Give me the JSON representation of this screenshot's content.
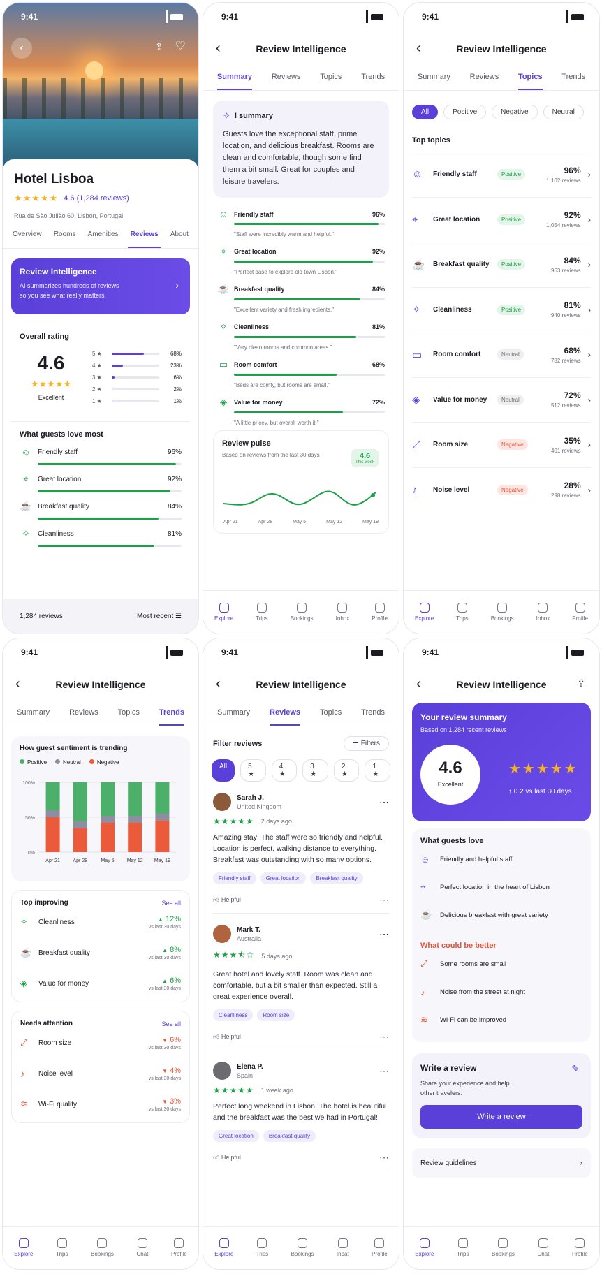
{
  "status_time": "9:41",
  "screen1": {
    "hotel_name": "Hotel Lisboa",
    "rating": "4.6 (1,284 reviews)",
    "address": "Rua de São Julião 60, Lisbon, Portugal",
    "tabs": [
      "Overview",
      "Rooms",
      "Amenities",
      "Reviews",
      "About"
    ],
    "ri_title": "Review Intelligence",
    "ri_desc_1": "AI summarizes hundreds of reviews",
    "ri_desc_2": "so you see what really matters.",
    "overall_title": "Overall rating",
    "overall_score": "4.6",
    "overall_label": "Excellent",
    "dist": [
      {
        "s": "5 ★",
        "p": "68%",
        "v": 68
      },
      {
        "s": "4 ★",
        "p": "23%",
        "v": 23
      },
      {
        "s": "3 ★",
        "p": "6%",
        "v": 6
      },
      {
        "s": "2 ★",
        "p": "2%",
        "v": 2
      },
      {
        "s": "1 ★",
        "p": "1%",
        "v": 1
      }
    ],
    "love_title": "What guests love most",
    "love": [
      {
        "n": "Friendly staff",
        "p": "96%",
        "v": 96
      },
      {
        "n": "Great location",
        "p": "92%",
        "v": 92
      },
      {
        "n": "Breakfast quality",
        "p": "84%",
        "v": 84
      },
      {
        "n": "Cleanliness",
        "p": "81%",
        "v": 81
      }
    ],
    "count": "1,284 reviews",
    "sort": "Most recent"
  },
  "app_title": "Review Intelligence",
  "tabs2": [
    "Summary",
    "Reviews",
    "Topics",
    "Trends"
  ],
  "screen2": {
    "ai_title": "I summary",
    "ai_text": "Guests love the exceptional staff, prime location, and delicious breakfast. Rooms are clean and comfortable, though some find them a bit small. Great for couples and leisure travelers.",
    "items": [
      {
        "n": "Friendly staff",
        "p": "96%",
        "v": 96,
        "q": "\"Staff were incredibly warm and helpful.\""
      },
      {
        "n": "Great location",
        "p": "92%",
        "v": 92,
        "q": "\"Perfect base to explore old town Lisbon.\""
      },
      {
        "n": "Breakfast quality",
        "p": "84%",
        "v": 84,
        "q": "\"Excellent variety and fresh ingredients.\""
      },
      {
        "n": "Cleanliness",
        "p": "81%",
        "v": 81,
        "q": "\"Very clean rooms and common areas.\""
      },
      {
        "n": "Room comfort",
        "p": "68%",
        "v": 68,
        "q": "\"Beds are comfy, but rooms are small.\""
      },
      {
        "n": "Value for money",
        "p": "72%",
        "v": 72,
        "q": "\"A little pricey, but overall worth it.\""
      }
    ],
    "pulse_title": "Review pulse",
    "pulse_sub": "Based on reviews from the last 30 days",
    "pulse_val": "4.6",
    "pulse_week": "This week",
    "pulse_dates": [
      "Apr 21",
      "Apr 28",
      "May 5",
      "May 12",
      "May 19"
    ]
  },
  "nav1": [
    "Explore",
    "Trips",
    "Bookings",
    "Inbox",
    "Profile"
  ],
  "nav2": [
    "Explore",
    "Trips",
    "Bookings",
    "Chat",
    "Profile"
  ],
  "nav3": [
    "Explore",
    "Trips",
    "Bookings",
    "Inbat",
    "Profile"
  ],
  "screen3": {
    "filters": [
      "All",
      "Positive",
      "Negative",
      "Neutral"
    ],
    "section": "Top topics",
    "topics": [
      {
        "n": "Friendly staff",
        "b": "Positive",
        "c": "pos",
        "p": "96%",
        "r": "1,102 reviews"
      },
      {
        "n": "Great location",
        "b": "Positive",
        "c": "pos",
        "p": "92%",
        "r": "1,054 reviews"
      },
      {
        "n": "Breakfast quality",
        "b": "Positive",
        "c": "pos",
        "p": "84%",
        "r": "963 reviews"
      },
      {
        "n": "Cleanliness",
        "b": "Positive",
        "c": "pos",
        "p": "81%",
        "r": "940 reviews"
      },
      {
        "n": "Room comfort",
        "b": "Neutral",
        "c": "neu",
        "p": "68%",
        "r": "782 reviews"
      },
      {
        "n": "Value for money",
        "b": "Neutral",
        "c": "neu",
        "p": "72%",
        "r": "512 reviews"
      },
      {
        "n": "Room size",
        "b": "Negative",
        "c": "neg",
        "p": "35%",
        "r": "401 reviews"
      },
      {
        "n": "Noise level",
        "b": "Negative",
        "c": "neg",
        "p": "28%",
        "r": "298 reviews"
      }
    ]
  },
  "screen4": {
    "chart_title": "How guest sentiment is trending",
    "legend": [
      "Positive",
      "Neutral",
      "Negative"
    ],
    "yticks": [
      "100%",
      "50%",
      "0%"
    ],
    "improving_title": "Top improving",
    "see_all": "See all",
    "improving": [
      {
        "n": "Cleanliness",
        "d": "12%"
      },
      {
        "n": "Breakfast quality",
        "d": "8%"
      },
      {
        "n": "Value for money",
        "d": "6%"
      }
    ],
    "attention_title": "Needs attention",
    "attention": [
      {
        "n": "Room size",
        "d": "6%"
      },
      {
        "n": "Noise level",
        "d": "4%"
      },
      {
        "n": "Wi-Fi quality",
        "d": "3%"
      }
    ],
    "vs": "vs last 30 days"
  },
  "chart_data": {
    "type": "bar",
    "title": "How guest sentiment is trending",
    "categories": [
      "Apr 21",
      "Apr 28",
      "May 5",
      "May 12",
      "May 19"
    ],
    "series": [
      {
        "name": "Positive",
        "values": [
          40,
          56,
          48,
          48,
          45
        ]
      },
      {
        "name": "Neutral",
        "values": [
          10,
          10,
          10,
          10,
          10
        ]
      },
      {
        "name": "Negative",
        "values": [
          50,
          34,
          42,
          42,
          45
        ]
      }
    ],
    "ylim": [
      0,
      100
    ],
    "yticks": [
      "0%",
      "50%",
      "100%"
    ],
    "stacked": true,
    "colors": {
      "Positive": "#4caf6a",
      "Neutral": "#8e8ea0",
      "Negative": "#ec5a3c"
    }
  },
  "screen5": {
    "filter_title": "Filter reviews",
    "filters_btn": "Filters",
    "star_filters": [
      "All",
      "5 ★",
      "4 ★",
      "3 ★",
      "2 ★",
      "1 ★"
    ],
    "reviews": [
      {
        "name": "Sarah J.",
        "country": "United Kingdom",
        "stars": 5,
        "ago": "2 days ago",
        "text": "Amazing stay! The staff were so friendly and helpful. Location is perfect, walking distance to everything. Breakfast was outstanding with so many options.",
        "chips": [
          "Friendly staff",
          "Great location",
          "Breakfast quality"
        ]
      },
      {
        "name": "Mark T.",
        "country": "Australia",
        "stars": 3.5,
        "ago": "5 days ago",
        "text": "Great hotel and lovely staff. Room was clean and comfortable, but a bit smaller than expected. Still a great experience overall.",
        "chips": [
          "Cleanliness",
          "Room size"
        ]
      },
      {
        "name": "Elena P.",
        "country": "Spain",
        "stars": 5,
        "ago": "1 week ago",
        "text": "Perfect long weekend in Lisbon. The hotel is beautiful and the breakfast was the best we had in Portugal!",
        "chips": [
          "Great location",
          "Breakfast quality"
        ]
      }
    ],
    "helpful": "Helpful"
  },
  "screen6": {
    "sum_title": "Your review summary",
    "sum_sub": "Based on 1,284 recent reviews",
    "score": "4.6",
    "score_label": "Excellent",
    "delta": "0.2  vs last 30 days",
    "love_title": "What guests love",
    "love": [
      "Friendly and helpful staff",
      "Perfect location in the heart of Lisbon",
      "Delicious breakfast with great variety"
    ],
    "better_title": "What could be better",
    "better": [
      "Some rooms are small",
      "Noise from the street at night",
      "Wi-Fi can be improved"
    ],
    "write_title": "Write a review",
    "write_desc_1": "Share your experience and help",
    "write_desc_2": "other travelers.",
    "write_btn": "Write a review",
    "guidelines": "Review guidelines"
  },
  "colors": {
    "accent": "#5b3fd9",
    "positive": "#1f9f4a",
    "negative": "#e4533a",
    "star": "#f4b226"
  }
}
